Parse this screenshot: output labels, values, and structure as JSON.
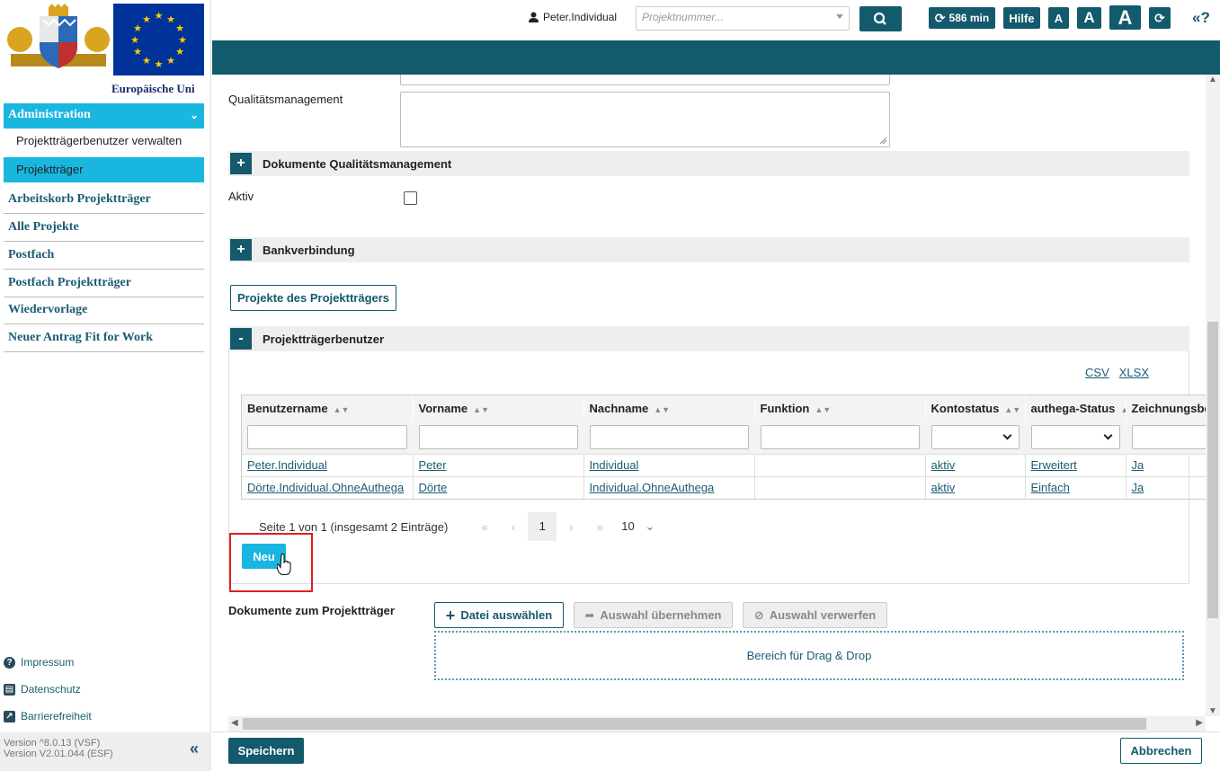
{
  "logos": {
    "eu_text": "Europäische Uni"
  },
  "sidebar": {
    "admin_label": "Administration",
    "sub_items": [
      "Projektträgerbenutzer verwalten",
      "Projektträger"
    ],
    "items": [
      "Arbeitskorb Projektträger",
      "Alle Projekte",
      "Postfach",
      "Postfach Projektträger",
      "Wiedervorlage",
      "Neuer Antrag Fit for Work"
    ],
    "footer": {
      "impressum": "Impressum",
      "datenschutz": "Datenschutz",
      "barrierefreiheit": "Barrierefreiheit"
    },
    "version_vsf": "Version ^8.0.13 (VSF)",
    "version_esf": "Version V2.01.044 (ESF)",
    "collapse_glyph": "«"
  },
  "topbar": {
    "username": "Peter.Individual",
    "project_placeholder": "Projektnummer...",
    "timer": "586 min",
    "help": "Hilfe",
    "font_small": "A",
    "font_medium": "A",
    "font_large": "A",
    "help_icon": "«?"
  },
  "form": {
    "qm_label": "Qualitätsmanagement",
    "docs_qm_title": "Dokumente Qualitätsmanagement",
    "aktiv_label": "Aktiv",
    "bank_title": "Bankverbindung",
    "projects_button": "Projekte des Projektträgers",
    "users_title": "Projektträgerbenutzer",
    "plus": "+",
    "minus": "-"
  },
  "users_table": {
    "export_csv": "CSV",
    "export_xlsx": "XLSX",
    "columns": [
      "Benutzername",
      "Vorname",
      "Nachname",
      "Funktion",
      "Kontostatus",
      "authega-Status",
      "Zeichnungsberechtigt"
    ],
    "rows": [
      [
        "Peter.Individual",
        "Peter",
        "Individual",
        "",
        "aktiv",
        "Erweitert",
        "Ja"
      ],
      [
        "Dörte.Individual.OhneAuthega",
        "Dörte",
        "Individual.OhneAuthega",
        "",
        "aktiv",
        "Einfach",
        "Ja"
      ]
    ],
    "pager_text": "Seite 1 von 1 (insgesamt 2 Einträge)",
    "current_page": "1",
    "page_size": "10",
    "new_button": "Neu"
  },
  "documents": {
    "label": "Dokumente zum Projektträger",
    "select_file": "Datei auswählen",
    "apply": "Auswahl übernehmen",
    "discard": "Auswahl verwerfen",
    "dropzone": "Bereich für Drag & Drop"
  },
  "bottom": {
    "save": "Speichern",
    "cancel": "Abbrechen"
  },
  "colors": {
    "primary": "#135a6c",
    "accent": "#19b6e0",
    "highlight": "#e02020"
  }
}
